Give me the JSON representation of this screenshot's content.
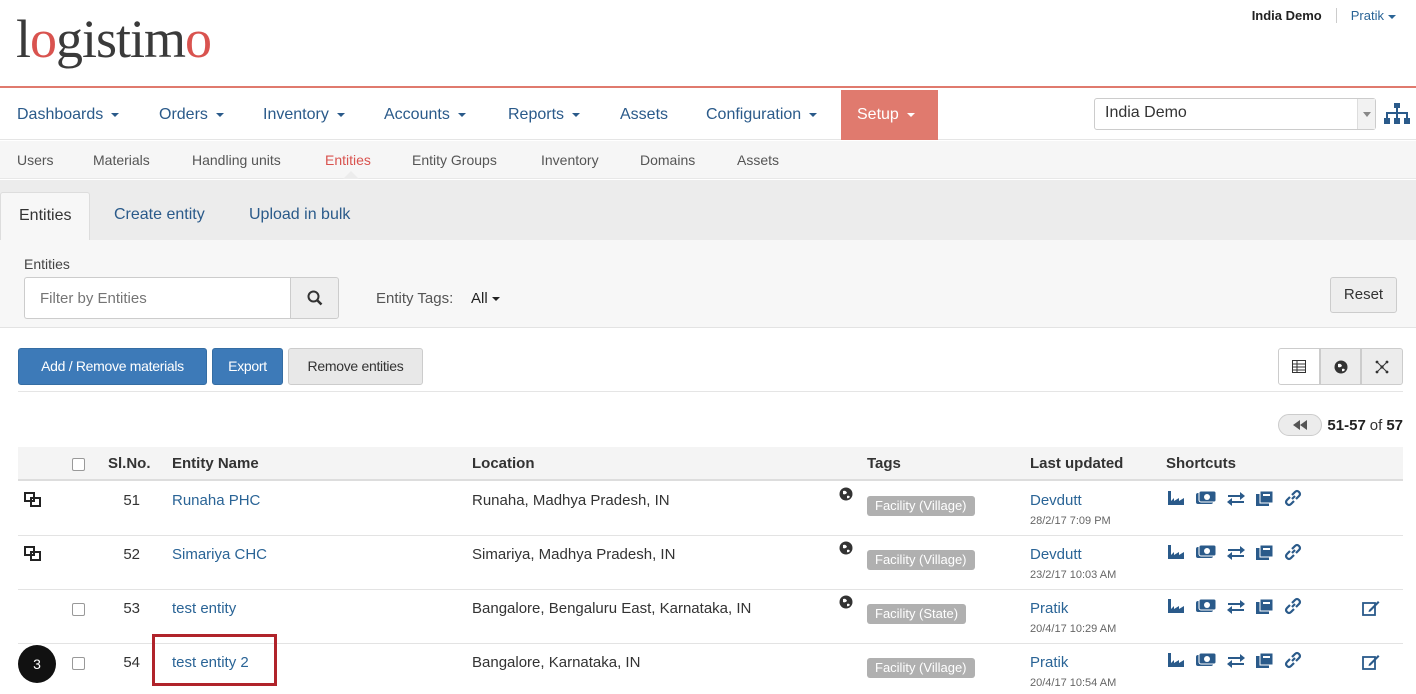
{
  "header": {
    "logo_main": "logistimo",
    "domain_name": "India Demo",
    "user_name": "Pratik"
  },
  "main_nav": {
    "items": [
      {
        "label": "Dashboards",
        "dropdown": true
      },
      {
        "label": "Orders",
        "dropdown": true
      },
      {
        "label": "Inventory",
        "dropdown": true
      },
      {
        "label": "Accounts",
        "dropdown": true
      },
      {
        "label": "Reports",
        "dropdown": true
      },
      {
        "label": "Assets",
        "dropdown": false
      },
      {
        "label": "Configuration",
        "dropdown": true
      },
      {
        "label": "Setup",
        "dropdown": true,
        "active": true
      }
    ],
    "domain_select_value": "India Demo"
  },
  "sub_nav": {
    "items": [
      "Users",
      "Materials",
      "Handling units",
      "Entities",
      "Entity Groups",
      "Inventory",
      "Domains",
      "Assets"
    ],
    "active": "Entities"
  },
  "tabs": [
    "Entities",
    "Create entity",
    "Upload in bulk"
  ],
  "filter": {
    "label": "Entities",
    "placeholder": "Filter by Entities",
    "tags_label": "Entity Tags:",
    "tags_value": "All",
    "reset_label": "Reset"
  },
  "actions": {
    "add_remove": "Add / Remove materials",
    "export": "Export",
    "remove": "Remove entities"
  },
  "pagination": {
    "range": "51-57",
    "of": "of",
    "total": "57"
  },
  "table": {
    "headers": {
      "sl": "Sl.No.",
      "name": "Entity Name",
      "location": "Location",
      "tags": "Tags",
      "updated": "Last updated",
      "shortcuts": "Shortcuts"
    },
    "rows": [
      {
        "sl": "51",
        "name": "Runaha PHC",
        "location": "Runaha, Madhya Pradesh, IN",
        "tag": "Facility (Village)",
        "user": "Devdutt",
        "time": "28/2/17 7:09 PM",
        "has_geo": true,
        "linked": true
      },
      {
        "sl": "52",
        "name": "Simariya CHC",
        "location": "Simariya, Madhya Pradesh, IN",
        "tag": "Facility (Village)",
        "user": "Devdutt",
        "time": "23/2/17 10:03 AM",
        "has_geo": true,
        "linked": true
      },
      {
        "sl": "53",
        "name": "test entity",
        "location": "Bangalore, Bengaluru East, Karnataka, IN",
        "tag": "Facility (State)",
        "user": "Pratik",
        "time": "20/4/17 10:29 AM",
        "has_geo": true,
        "linked": false
      },
      {
        "sl": "54",
        "name": "test entity 2",
        "location": "Bangalore, Karnataka, IN",
        "tag": "Facility (Village)",
        "user": "Pratik",
        "time": "20/4/17 10:54 AM",
        "has_geo": false,
        "linked": false
      }
    ]
  },
  "annotation": {
    "step": "3"
  },
  "colors": {
    "accent": "#e07a6e",
    "link": "#2a6496",
    "primary_button": "#3d7ab8",
    "highlight": "#b0232a"
  }
}
